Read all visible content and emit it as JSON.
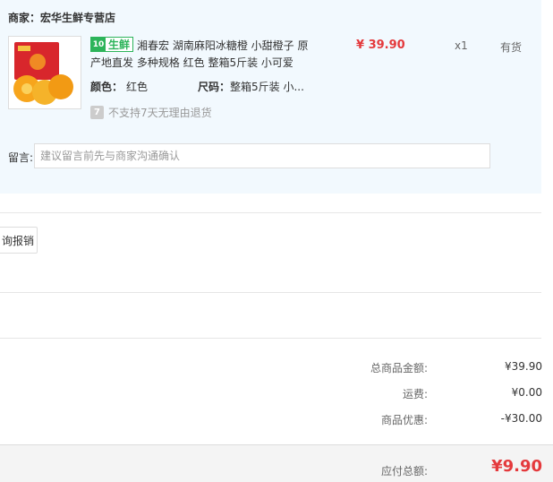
{
  "shop": {
    "name": "商家：宏华生鲜专营店"
  },
  "item": {
    "tag_label": "生鲜",
    "title": "湘春宏 湖南麻阳冰糖橙 小甜橙子 原产地直发 多种规格 红色 整箱5斤装 小可爱",
    "color_label": "颜色：",
    "color_value": "红色",
    "size_label": "尺码：",
    "size_value": "整箱5斤装 小...",
    "price": "¥ 39.90",
    "qty": "x1",
    "stock": "有货",
    "no_return": "不支持7天无理由退货"
  },
  "memo": {
    "label": "留言:",
    "placeholder": "建议留言前先与商家沟通确认"
  },
  "reimburse_button": "询报销",
  "summary": {
    "goods_label": "总商品金额:",
    "goods_value": "¥39.90",
    "shipping_label": "运费:",
    "shipping_value": "¥0.00",
    "discount_label": "商品优惠:",
    "discount_value": "-¥30.00",
    "total_label": "应付总额:",
    "total_value": "¥9.90"
  },
  "colors": {
    "accent_red": "#e4393c",
    "fresh_green": "#2db45a",
    "panel_bg": "#f2f9fe"
  }
}
